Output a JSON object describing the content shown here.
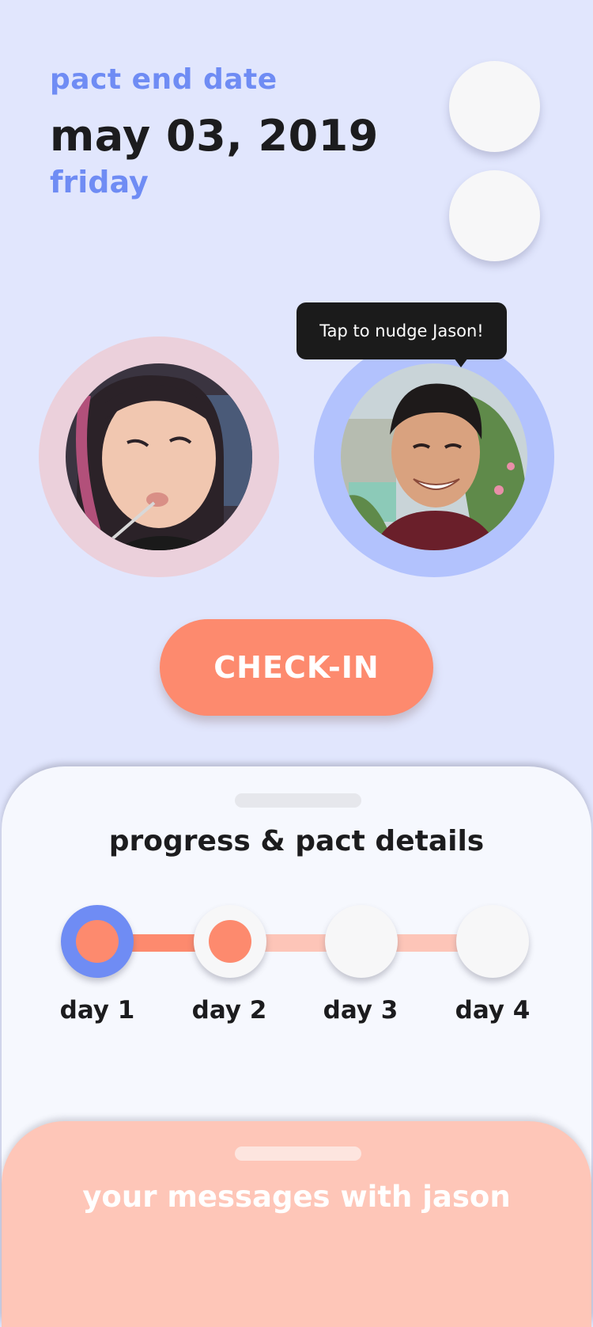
{
  "header": {
    "label": "pact end date",
    "date": "may 03, 2019",
    "weekday": "friday"
  },
  "tooltip": {
    "text": "Tap to nudge Jason!"
  },
  "primary_action": {
    "label": "CHECK-IN"
  },
  "progress_sheet": {
    "title": "progress & pact details",
    "days": [
      {
        "label": "day 1",
        "state": "current"
      },
      {
        "label": "day 2",
        "state": "done"
      },
      {
        "label": "day 3",
        "state": "upcoming"
      },
      {
        "label": "day 4",
        "state": "upcoming"
      }
    ]
  },
  "messages_sheet": {
    "title": "your messages with jason"
  },
  "colors": {
    "background": "#e1e6fd",
    "accent_blue": "#6f8cf4",
    "accent_coral": "#fd8a6e",
    "user_ring": "#ebd0db",
    "partner_ring": "#b2c2fd",
    "messages_sheet": "#fec6b8"
  },
  "icons": {
    "user_avatar": "user-photo-avatar",
    "partner_avatar": "partner-photo-avatar"
  }
}
